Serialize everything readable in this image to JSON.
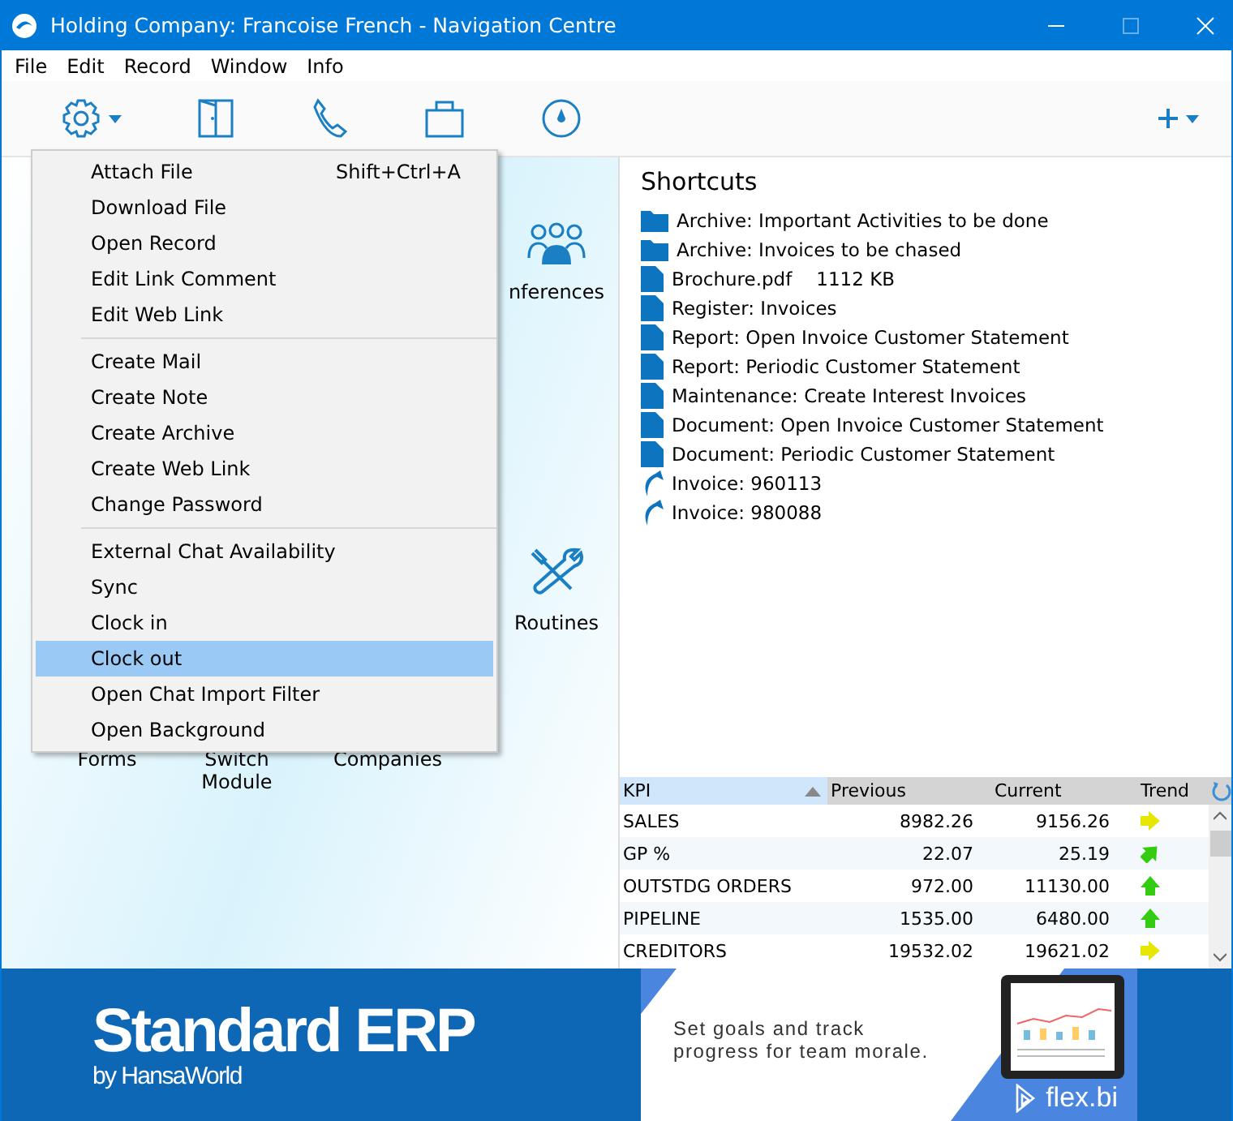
{
  "window": {
    "title": "Holding Company: Francoise French - Navigation Centre"
  },
  "menu_bar": [
    "File",
    "Edit",
    "Record",
    "Window",
    "Info"
  ],
  "context_menu": {
    "groups": [
      [
        {
          "label": "Attach File",
          "shortcut": "Shift+Ctrl+A",
          "selected": false
        },
        {
          "label": "Download File",
          "selected": false
        },
        {
          "label": "Open Record",
          "selected": false
        },
        {
          "label": "Edit Link Comment",
          "selected": false
        },
        {
          "label": "Edit Web Link",
          "selected": false
        }
      ],
      [
        {
          "label": "Create Mail",
          "selected": false
        },
        {
          "label": "Create Note",
          "selected": false
        },
        {
          "label": "Create Archive",
          "selected": false
        },
        {
          "label": "Create Web Link",
          "selected": false
        },
        {
          "label": "Change Password",
          "selected": false
        }
      ],
      [
        {
          "label": "External Chat Availability",
          "selected": false
        },
        {
          "label": "Sync",
          "selected": false
        },
        {
          "label": "Clock in",
          "selected": false
        },
        {
          "label": "Clock out",
          "selected": true
        },
        {
          "label": "Open Chat Import Filter",
          "selected": false
        },
        {
          "label": "Open Background",
          "selected": false
        }
      ]
    ]
  },
  "modules": [
    {
      "kind": "people",
      "label": "nferences"
    },
    {
      "kind": "tools",
      "label": "Routines"
    }
  ],
  "bottom_modules": [
    "Forms",
    "Switch Module",
    "Companies"
  ],
  "shortcuts": {
    "title": "Shortcuts",
    "items": [
      {
        "kind": "folder",
        "label": "Archive: Important Activities to be done"
      },
      {
        "kind": "folder",
        "label": "Archive: Invoices to be chased"
      },
      {
        "kind": "document",
        "label": "Brochure.pdf",
        "size": "1112 KB"
      },
      {
        "kind": "document",
        "label": "Register: Invoices"
      },
      {
        "kind": "document",
        "label": "Report: Open Invoice Customer Statement"
      },
      {
        "kind": "document",
        "label": "Report: Periodic Customer Statement"
      },
      {
        "kind": "document",
        "label": "Maintenance: Create Interest Invoices"
      },
      {
        "kind": "document",
        "label": "Document: Open Invoice Customer Statement"
      },
      {
        "kind": "document",
        "label": "Document: Periodic Customer Statement"
      },
      {
        "kind": "link",
        "label": "Invoice: 960113"
      },
      {
        "kind": "link",
        "label": "Invoice: 980088"
      }
    ]
  },
  "kpi": {
    "columns": [
      "KPI",
      "Previous",
      "Current",
      "Trend"
    ],
    "rows": [
      {
        "kpi": "SALES",
        "previous": "8982.26",
        "current": "9156.26",
        "kind": "flat"
      },
      {
        "kpi": "GP %",
        "previous": "22.07",
        "current": "25.19",
        "kind": "rising"
      },
      {
        "kpi": "OUTSTDG ORDERS",
        "previous": "972.00",
        "current": "11130.00",
        "kind": "up"
      },
      {
        "kpi": "PIPELINE",
        "previous": "1535.00",
        "current": "6480.00",
        "kind": "up"
      },
      {
        "kpi": "CREDITORS",
        "previous": "19532.02",
        "current": "19621.02",
        "kind": "flat"
      }
    ]
  },
  "banner": {
    "brand": "Standard ERP",
    "byline": "by HansaWorld",
    "tagline": "Set goals and track progress for team morale.",
    "partner": "flex.bi"
  }
}
